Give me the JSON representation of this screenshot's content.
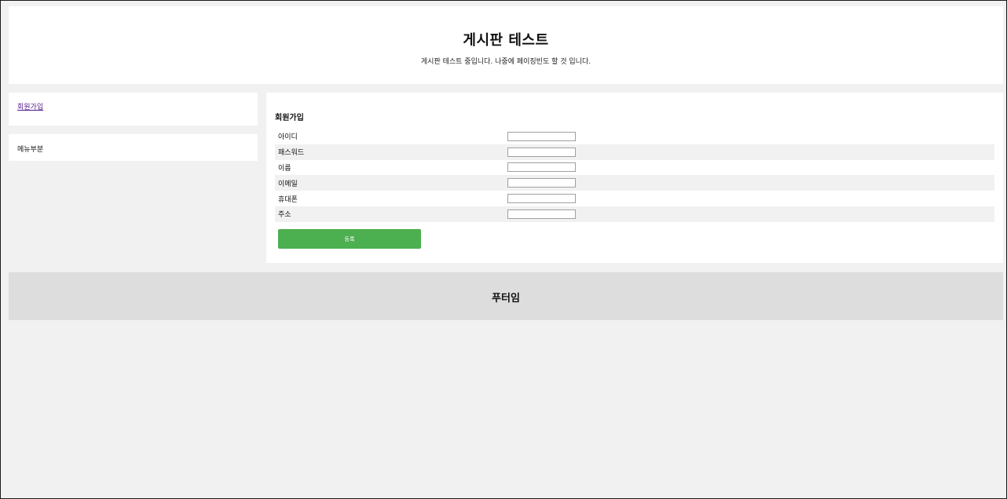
{
  "header": {
    "title": "게시판 테스트",
    "subtitle": "게시판 테스트 중입니다. 나중에 페이징빈도 할 것 입니다."
  },
  "sidebar": {
    "link_label": "회원가입",
    "menu_label": "메뉴부분"
  },
  "form": {
    "heading": "회원가입",
    "fields": [
      {
        "label": "아이디",
        "value": ""
      },
      {
        "label": "패스워드",
        "value": ""
      },
      {
        "label": "이름",
        "value": ""
      },
      {
        "label": "이메일",
        "value": ""
      },
      {
        "label": "휴대폰",
        "value": ""
      },
      {
        "label": "주소",
        "value": ""
      }
    ],
    "submit_label": "등록",
    "submit_color": "#4caf50"
  },
  "footer": {
    "text": "푸터임"
  }
}
